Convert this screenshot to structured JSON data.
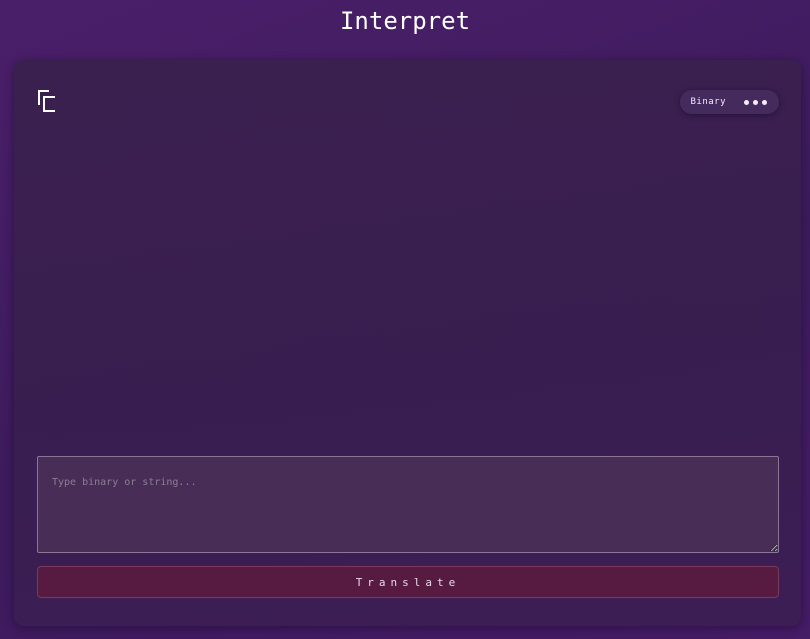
{
  "app": {
    "title": "Interpret"
  },
  "toolbar": {
    "copy_icon": "copy-icon",
    "mode_label": "Binary",
    "more_icon": "more-horizontal-icon"
  },
  "input": {
    "value": "",
    "placeholder": "Type binary or string..."
  },
  "actions": {
    "translate_label": "Translate"
  },
  "colors": {
    "background": "#45205f",
    "panel": "#3a2050",
    "input_bg": "#4a3058",
    "button": "#571b42",
    "text": "#ffffff"
  }
}
